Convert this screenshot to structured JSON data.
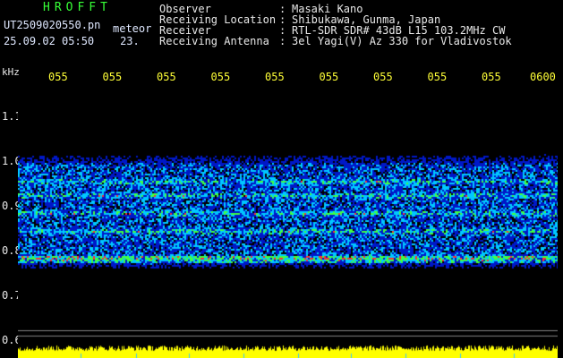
{
  "header": {
    "brand": "HROFFT",
    "filename": "UT2509020550.pn",
    "tag": "meteor",
    "date_time": "25.09.02 05:50",
    "count": "23."
  },
  "station": [
    {
      "key": "Observer",
      "sep": ":",
      "value": "Masaki Kano"
    },
    {
      "key": "Receiving Location",
      "sep": ":",
      "value": "Shibukawa, Gunma, Japan"
    },
    {
      "key": "Receiver",
      "sep": ":",
      "value": "RTL-SDR SDR# 43dB L15 103.2MHz CW"
    },
    {
      "key": "Receiving Antenna",
      "sep": ":",
      "value": "3el Yagi(V) Az 330 for Vladivostok"
    }
  ],
  "chart_data": {
    "type": "heatmap",
    "ylabel": "kHz",
    "y_ticks": [
      "1.1",
      "1.0",
      "0.9",
      "0.8",
      "0.7",
      "0.6"
    ],
    "x_ticks": [
      "055",
      "055",
      "055",
      "055",
      "055",
      "055",
      "055",
      "055",
      "055",
      "0600"
    ],
    "ylim": [
      0.6,
      1.1
    ],
    "signal_band": [
      0.77,
      1.0
    ],
    "strong_lines_khz": [
      0.955,
      0.925,
      0.885,
      0.845,
      0.785
    ],
    "colors": {
      "background": "#000000",
      "low": "#0018c8",
      "mid": "#00c8ff",
      "high": "#40ff40",
      "peak": "#ff3030",
      "level_bar": "#ffff00"
    }
  }
}
